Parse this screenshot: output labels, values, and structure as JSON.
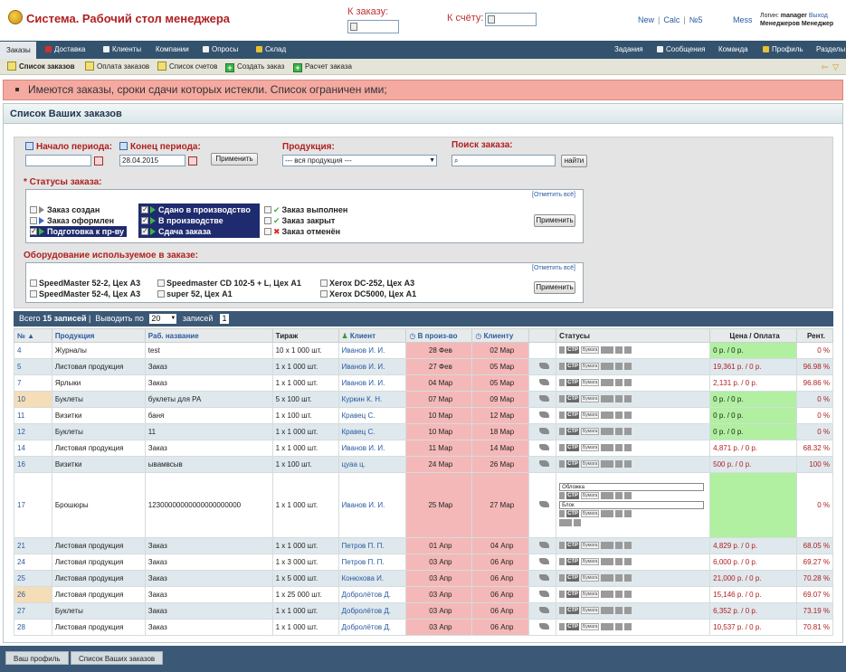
{
  "header": {
    "title": "Система. Рабочий стол менеджера",
    "order_label": "К заказу:",
    "invoice_label": "К счёту:",
    "links": [
      "New",
      "Calc",
      "№5"
    ],
    "mess": "Mess",
    "login_label": "Логин:",
    "login": "manager",
    "logout": "Выход",
    "user": "Менеджеров Менеджер"
  },
  "nav": {
    "items": [
      "Заказы",
      "Доставка",
      "Клиенты",
      "Компании",
      "Опросы",
      "Склад"
    ],
    "right": [
      "Задания",
      "Сообщения",
      "Команда",
      "Профиль",
      "Разделы"
    ]
  },
  "subnav": {
    "items": [
      "Список заказов",
      "Оплата заказов",
      "Список счетов",
      "Создать заказ",
      "Расчет заказа"
    ]
  },
  "alert": "Имеются заказы, сроки сдачи которых истекли. Список ограничен ими;",
  "panel": {
    "title": "Список Ваших заказов"
  },
  "filters": {
    "period_start_label": "Начало периода:",
    "period_end_label": "Конец периода:",
    "period_end": "28.04.2015",
    "apply": "Применить",
    "product_label": "Продукция:",
    "product_value": "--- вся продукция ---",
    "search_label": "Поиск заказа:",
    "search_btn": "найти",
    "statuses_label": "* Статусы заказа:",
    "mark_all": "[Отметить всё]",
    "statuses_col1": [
      "Заказ создан",
      "Заказ оформлен",
      "Подготовка к пр-ву"
    ],
    "statuses_col2": [
      "Сдано в производство",
      "В производстве",
      "Сдача заказа"
    ],
    "statuses_col3": [
      "Заказ выполнен",
      "Заказ закрыт",
      "Заказ отменён"
    ],
    "apply2": "Применить",
    "equipment_label": "Оборудование используемое в заказе:",
    "equipment": [
      "SpeedMaster 52-2, Цех A3",
      "SpeedMaster 52-4, Цех A3",
      "Speedmaster CD 102-5 + L, Цех A1",
      "super 52, Цех A1",
      "Xerox DC-252, Цех A3",
      "Xerox DC5000, Цех A1"
    ],
    "apply3": "Применить"
  },
  "table": {
    "total_prefix": "Всего",
    "total_count": "15 записей",
    "sep": "|",
    "show_by": "Выводить по",
    "page_size": "20",
    "records": "записей",
    "page": "1",
    "headers": [
      "№",
      "Продукция",
      "Раб. название",
      "Тираж",
      "Клиент",
      "В произ-во",
      "Клиенту",
      "",
      "Статусы",
      "Цена / Оплата",
      "Рент."
    ],
    "rows": [
      {
        "n": "4",
        "product": "Журналы",
        "name": "test",
        "qty": "10 х 1 000 шт.",
        "client": "Иванов И. И.",
        "prod": "28 Фев",
        "due": "02 Мар",
        "price": "0 р. / 0 р.",
        "paid": true,
        "pct": "0 %",
        "eq": false
      },
      {
        "n": "5",
        "product": "Листовая продукция",
        "name": "Заказ",
        "qty": "1 х 1 000 шт.",
        "client": "Иванов И. И.",
        "prod": "27 Фев",
        "due": "05 Мар",
        "price": "19,361 р. / 0 р.",
        "paid": false,
        "pct": "96.98 %",
        "eq": true
      },
      {
        "n": "7",
        "product": "Ярлыки",
        "name": "Заказ",
        "qty": "1 х 1 000 шт.",
        "client": "Иванов И. И.",
        "prod": "04 Мар",
        "due": "05 Мар",
        "price": "2,131 р. / 0 р.",
        "paid": false,
        "pct": "96.86 %",
        "eq": true
      },
      {
        "n": "10",
        "product": "Буклеты",
        "name": "буклеты для РА",
        "qty": "5 х 100 шт.",
        "client": "Куркин К. Н.",
        "prod": "07 Мар",
        "due": "09 Мар",
        "price": "0 р. / 0 р.",
        "paid": true,
        "pct": "0 %",
        "eq": true,
        "hl": true
      },
      {
        "n": "11",
        "product": "Визитки",
        "name": "баня",
        "qty": "1 х 100 шт.",
        "client": "Кравец С.",
        "prod": "10 Мар",
        "due": "12 Мар",
        "price": "0 р. / 0 р.",
        "paid": true,
        "pct": "0 %",
        "eq": true
      },
      {
        "n": "12",
        "product": "Буклеты",
        "name": "11",
        "qty": "1 х 1 000 шт.",
        "client": "Кравец С.",
        "prod": "10 Мар",
        "due": "18 Мар",
        "price": "0 р. / 0 р.",
        "paid": true,
        "pct": "0 %",
        "eq": true
      },
      {
        "n": "14",
        "product": "Листовая продукция",
        "name": "Заказ",
        "qty": "1 х 1 000 шт.",
        "client": "Иванов И. И.",
        "prod": "11 Мар",
        "due": "14 Мар",
        "price": "4,871 р. / 0 р.",
        "paid": false,
        "pct": "68.32 %",
        "eq": true
      },
      {
        "n": "16",
        "product": "Визитки",
        "name": "ывамвсыв",
        "qty": "1 х 100 шт.",
        "client": "цуаа ц.",
        "prod": "24 Мар",
        "due": "26 Мар",
        "price": "500 р. / 0 р.",
        "paid": false,
        "pct": "100 %",
        "eq": true
      },
      {
        "n": "17",
        "product": "Брошюры",
        "name": "12300000000000000000000",
        "qty": "1 х 1 000 шт.",
        "client": "Иванов И. И.",
        "prod": "25 Мар",
        "due": "27 Мар",
        "price": "",
        "paid": true,
        "pct": "0 %",
        "eq": true,
        "big": true,
        "sub": [
          "Обложка",
          "Блок"
        ]
      },
      {
        "n": "21",
        "product": "Листовая продукция",
        "name": "Заказ",
        "qty": "1 х 1 000 шт.",
        "client": "Петров П. П.",
        "prod": "01 Апр",
        "due": "04 Апр",
        "price": "4,829 р. / 0 р.",
        "paid": false,
        "pct": "68.05 %",
        "eq": true
      },
      {
        "n": "24",
        "product": "Листовая продукция",
        "name": "Заказ",
        "qty": "1 х 3 000 шт.",
        "client": "Петров П. П.",
        "prod": "03 Апр",
        "due": "06 Апр",
        "price": "6,000 р. / 0 р.",
        "paid": false,
        "pct": "69.27 %",
        "eq": true
      },
      {
        "n": "25",
        "product": "Листовая продукция",
        "name": "Заказ",
        "qty": "1 х 5 000 шт.",
        "client": "Конюхова И.",
        "prod": "03 Апр",
        "due": "06 Апр",
        "price": "21,000 р. / 0 р.",
        "paid": false,
        "pct": "70.28 %",
        "eq": true
      },
      {
        "n": "26",
        "product": "Листовая продукция",
        "name": "Заказ",
        "qty": "1 х 25 000 шт.",
        "client": "Добролётов Д.",
        "prod": "03 Апр",
        "due": "06 Апр",
        "price": "15,146 р. / 0 р.",
        "paid": false,
        "pct": "69.07 %",
        "eq": true,
        "hl": true
      },
      {
        "n": "27",
        "product": "Буклеты",
        "name": "Заказ",
        "qty": "1 х 1 000 шт.",
        "client": "Добролётов Д.",
        "prod": "03 Апр",
        "due": "06 Апр",
        "price": "6,352 р. / 0 р.",
        "paid": false,
        "pct": "73.19 %",
        "eq": true
      },
      {
        "n": "28",
        "product": "Листовая продукция",
        "name": "Заказ",
        "qty": "1 х 1 000 шт.",
        "client": "Добролётов Д.",
        "prod": "03 Апр",
        "due": "06 Апр",
        "price": "10,537 р. / 0 р.",
        "paid": false,
        "pct": "70.81 %",
        "eq": true
      }
    ]
  },
  "footer": {
    "crumbs": [
      "Ваш профиль",
      "Список Ваших заказов"
    ]
  },
  "status_icon_labels": {
    "str": "СТР",
    "paper": "Бумага"
  }
}
